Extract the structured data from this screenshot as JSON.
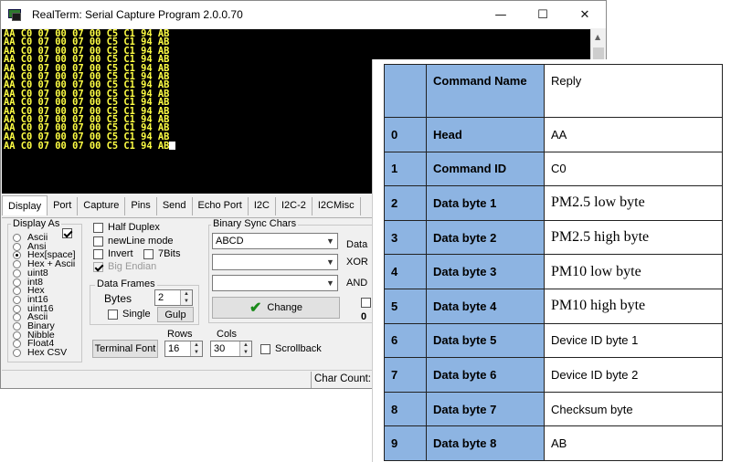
{
  "window": {
    "title": "RealTerm: Serial Capture Program 2.0.0.70",
    "controls": [
      "—",
      "☐",
      "✕"
    ]
  },
  "terminal": {
    "line": "AA C0 07 00 07 00 C5 C1 94 AB",
    "line_count": 14,
    "text_color": "#ffff44"
  },
  "tabs": [
    "Display",
    "Port",
    "Capture",
    "Pins",
    "Send",
    "Echo Port",
    "I2C",
    "I2C-2",
    "I2CMisc"
  ],
  "display": {
    "display_as_label": "Display As",
    "modes": [
      "Ascii",
      "Ansi",
      "Hex[space]",
      "Hex + Ascii",
      "uint8",
      "int8",
      "Hex",
      "int16",
      "uint16",
      "Ascii",
      "Binary",
      "Nibble",
      "Float4",
      "Hex CSV"
    ],
    "selected_mode_index": 2,
    "half_duplex": "Half Duplex",
    "newline_mode": "newLine mode",
    "invert": "Invert",
    "seven_bits": "7Bits",
    "big_endian": "Big Endian",
    "data_frames_label": "Data Frames",
    "bytes_label": "Bytes",
    "bytes_value": "2",
    "single_label": "Single",
    "gulp_label": "Gulp",
    "terminal_font_label": "Terminal Font",
    "rows_label": "Rows",
    "rows_value": "16",
    "cols_label": "Cols",
    "cols_value": "30",
    "scrollback_label": "Scrollback",
    "binary_sync_label": "Binary Sync Chars",
    "sync_value": "ABCD",
    "data_label": "Data",
    "xor_label": "XOR",
    "and_label": "AND",
    "change_label": "Change",
    "zero_label": "0"
  },
  "status": {
    "char_count_label": "Char Count:"
  },
  "protocol_table": {
    "headers": [
      "",
      "Command Name",
      "Reply"
    ],
    "rows": [
      {
        "idx": "0",
        "name": "Head",
        "reply": "AA"
      },
      {
        "idx": "1",
        "name": "Command ID",
        "reply": "C0"
      },
      {
        "idx": "2",
        "name": "Data byte 1",
        "reply": "PM2.5  low byte"
      },
      {
        "idx": "3",
        "name": "Data byte 2",
        "reply": "PM2.5 high byte"
      },
      {
        "idx": "4",
        "name": "Data byte 3",
        "reply": "PM10 low byte"
      },
      {
        "idx": "5",
        "name": "Data byte 4",
        "reply": "PM10 high byte"
      },
      {
        "idx": "6",
        "name": "Data byte 5",
        "reply": "Device ID byte 1"
      },
      {
        "idx": "7",
        "name": "Data byte 6",
        "reply": "Device ID byte 2"
      },
      {
        "idx": "8",
        "name": "Data byte 7",
        "reply": "Checksum byte"
      },
      {
        "idx": "9",
        "name": "Data byte 8",
        "reply": "AB"
      }
    ],
    "header_fill": "#8db4e2"
  }
}
